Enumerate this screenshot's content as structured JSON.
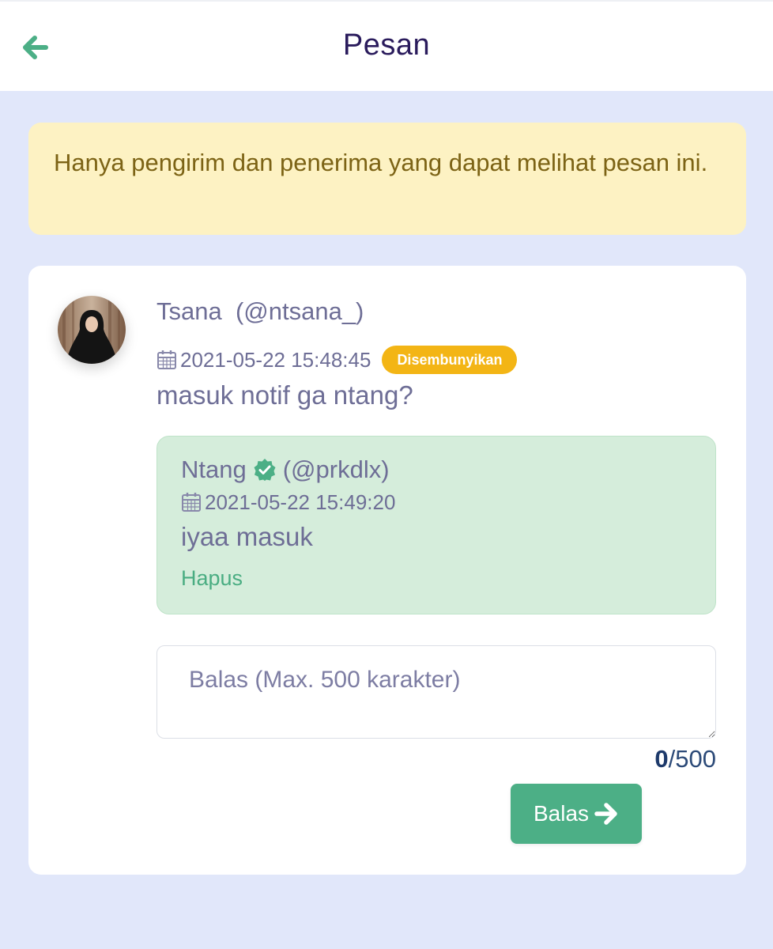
{
  "header": {
    "title": "Pesan",
    "back_icon": "arrow-left-icon"
  },
  "notice": {
    "text": "Hanya pengirim dan penerima yang dapat melihat pesan ini."
  },
  "message": {
    "sender": "Tsana  (@ntsana_)",
    "timestamp": "2021-05-22 15:48:45",
    "status_badge": "Disembunyikan",
    "text": "masuk notif ga ntang?"
  },
  "reply": {
    "name": "Ntang",
    "handle": "(@prkdlx)",
    "timestamp": "2021-05-22 15:49:20",
    "text": "iyaa masuk",
    "delete_label": "Hapus"
  },
  "reply_form": {
    "placeholder": "Balas (Max. 500 karakter)",
    "value": "",
    "count_current": "0",
    "count_max": "/500",
    "submit_label": "Balas"
  },
  "colors": {
    "accent_green": "#4caf86",
    "badge_yellow": "#f3b515",
    "page_background": "#e1e7fa",
    "notice_background": "#fdf2c3",
    "reply_background": "#d5eddb"
  }
}
